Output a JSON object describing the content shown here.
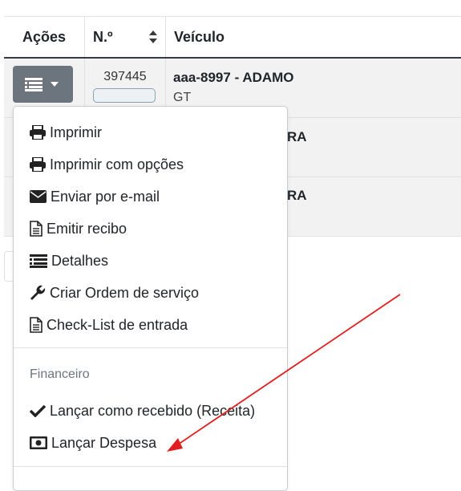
{
  "table": {
    "headers": {
      "acoes": "Ações",
      "numero": "N.º",
      "veiculo": "Veículo"
    },
    "rows": [
      {
        "numero": "397445",
        "veiculo_title": "aaa-8997 - ADAMO",
        "veiculo_sub": "GT"
      },
      {
        "veiculo_stub": "RA"
      },
      {
        "veiculo_stub": "RA"
      }
    ]
  },
  "menu": {
    "items": [
      {
        "label": "Imprimir",
        "icon": "printer-icon"
      },
      {
        "label": "Imprimir com opções",
        "icon": "printer-icon"
      },
      {
        "label": "Enviar por e-mail",
        "icon": "envelope-icon"
      },
      {
        "label": "Emitir recibo",
        "icon": "file-text-icon"
      },
      {
        "label": "Detalhes",
        "icon": "list-detail-icon"
      },
      {
        "label": "Criar Ordem de serviço",
        "icon": "wrench-icon"
      },
      {
        "label": "Check-List de entrada",
        "icon": "file-text-icon"
      }
    ],
    "financeiro_header": "Financeiro",
    "financeiro_items": [
      {
        "label": "Lançar como recebido (Receita)",
        "icon": "check-icon"
      },
      {
        "label": "Lançar Despesa",
        "icon": "money-bill-icon"
      }
    ]
  },
  "colors": {
    "button": "#6c757d",
    "arrow": "#e02020"
  }
}
